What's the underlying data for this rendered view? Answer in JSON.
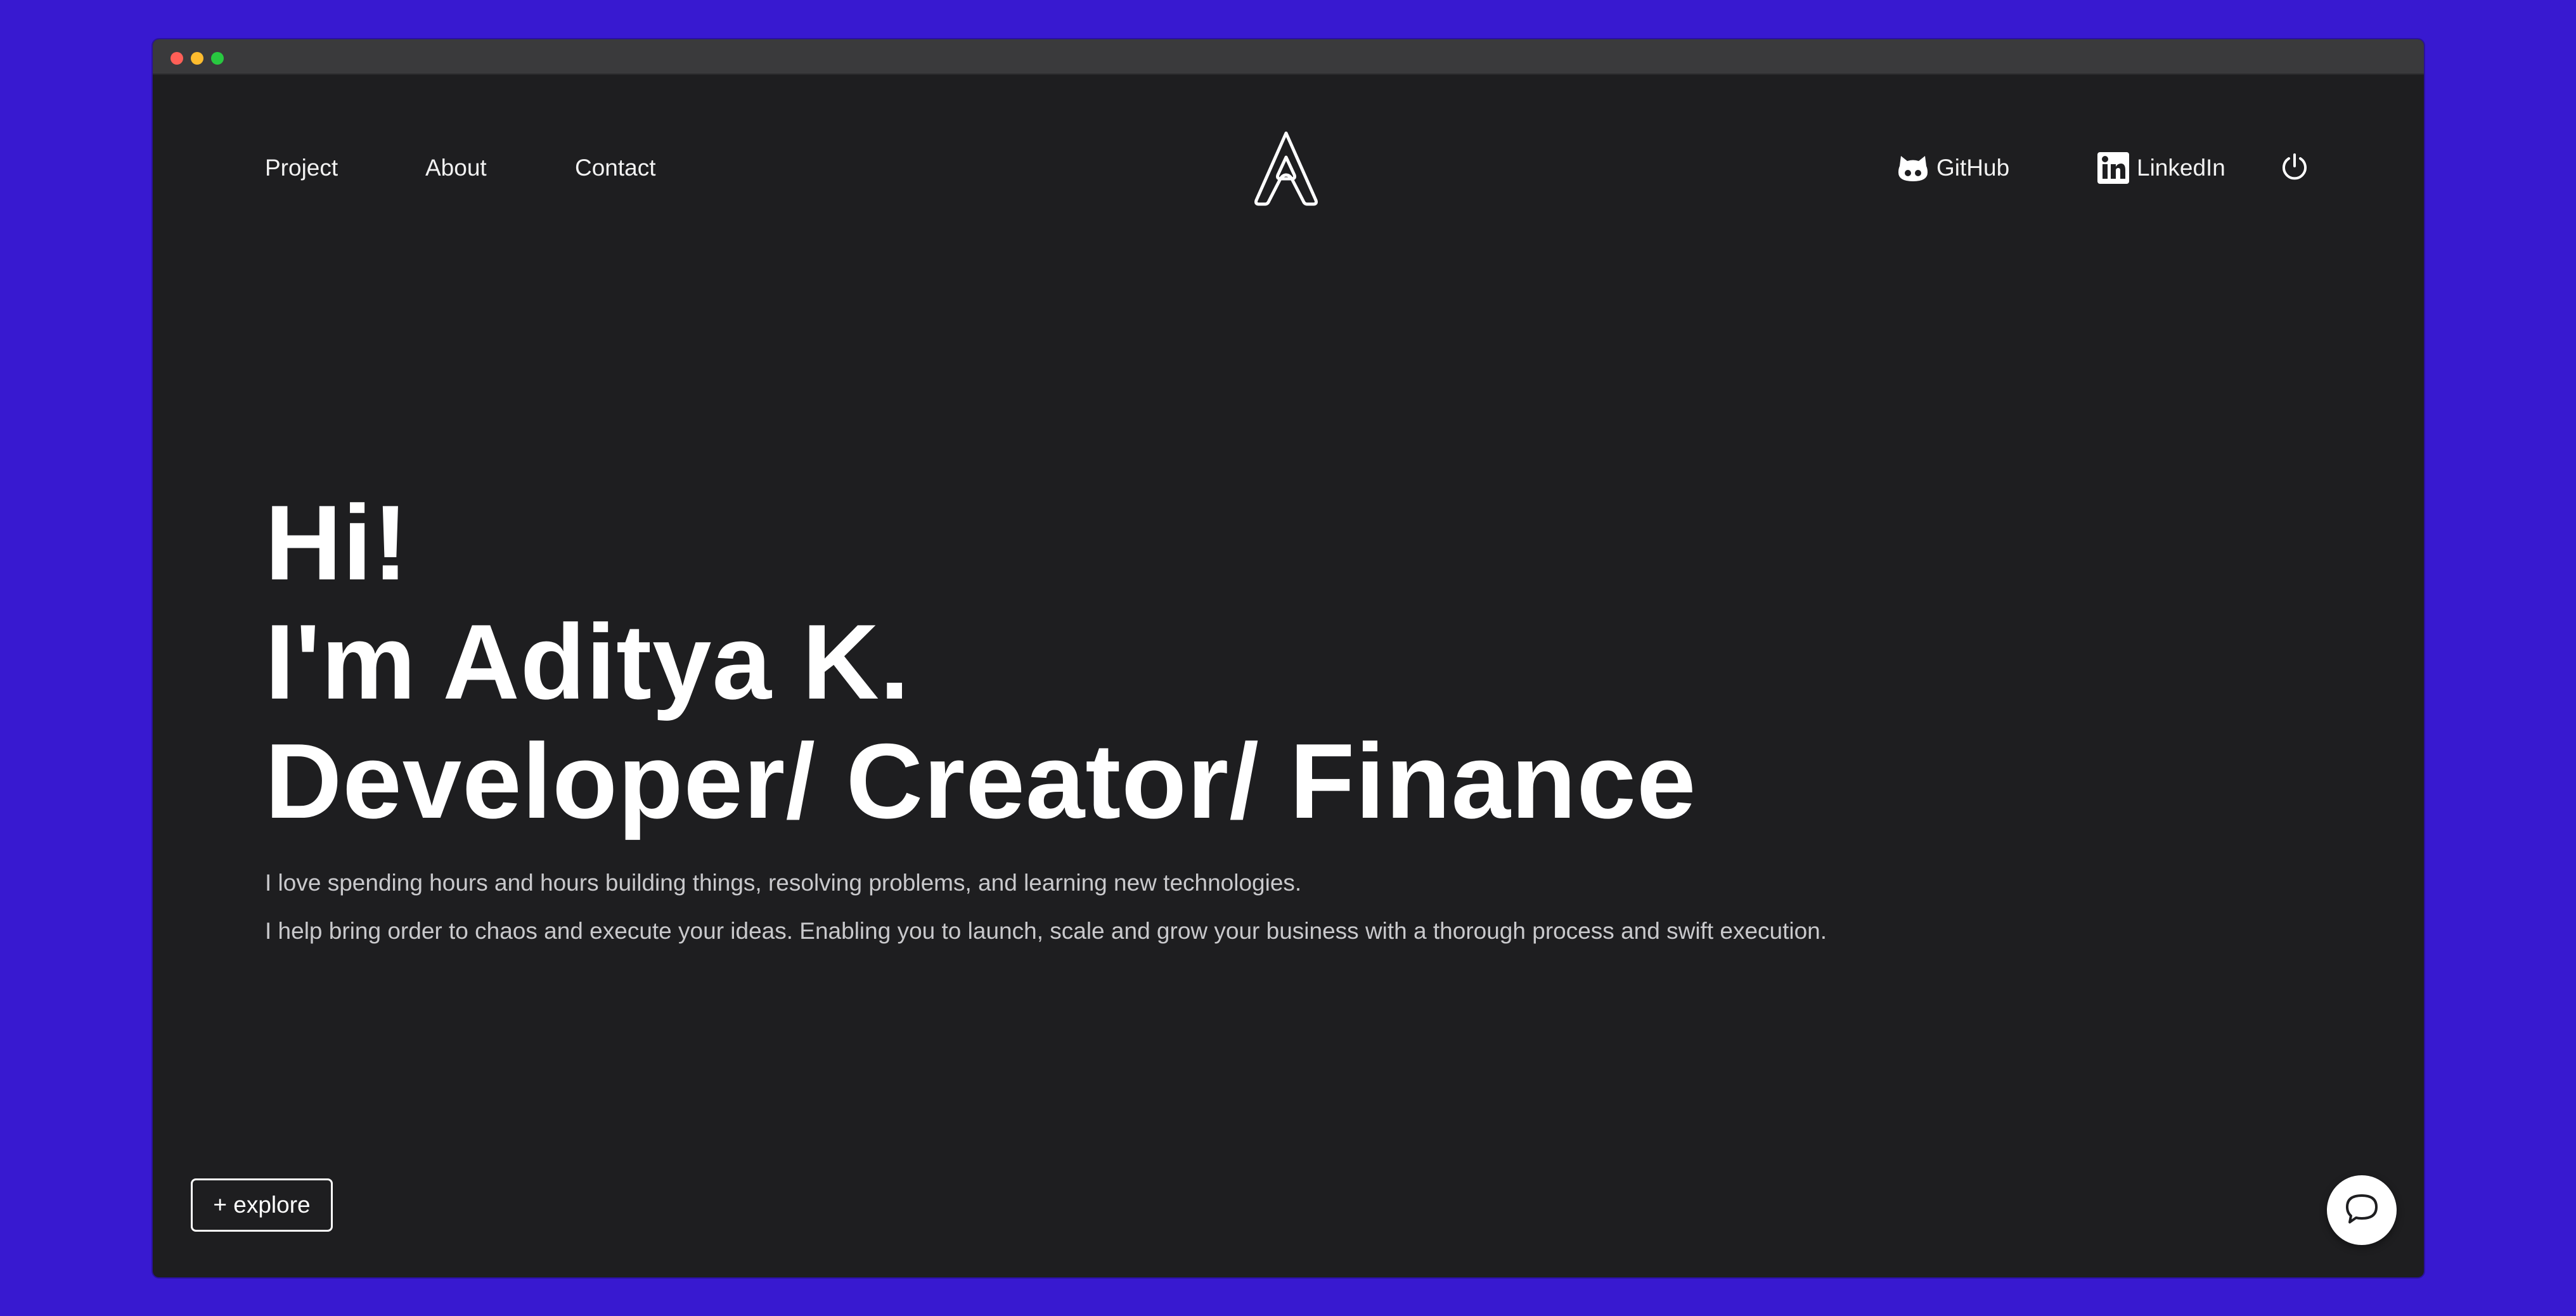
{
  "nav": {
    "links": [
      "Project",
      "About",
      "Contact"
    ],
    "logo_icon": "letter-a-logo-icon",
    "github_label": "GitHub",
    "github_icon": "github-octocat-icon",
    "linkedin_label": "LinkedIn",
    "linkedin_icon": "linkedin-icon",
    "power_icon": "power-icon"
  },
  "hero": {
    "greeting": "Hi!",
    "name_line": "I'm Aditya K.",
    "roles_line": "Developer/ Creator/ Finance",
    "description_1": "I love spending hours and hours building things, resolving problems, and learning new technologies.",
    "description_2": "I help bring order to chaos and execute your ideas. Enabling you to launch, scale and grow your business with a thorough process and swift execution."
  },
  "explore_button": "+ explore",
  "chat_icon": "chat-bubble-icon",
  "colors": {
    "page_background": "#3819d0",
    "window_background": "#1e1e20",
    "titlebar": "#3a3a3c",
    "text_primary": "#ffffff",
    "text_secondary": "#c9c9cc"
  }
}
